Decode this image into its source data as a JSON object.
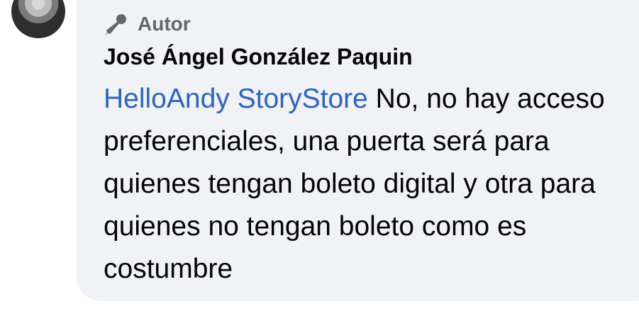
{
  "comment": {
    "badge_label": "Autor",
    "author_name": "José Ángel González Paquin",
    "mention": "HelloAndy StoryStore",
    "text": " No, no hay acceso preferenciales, una puerta será para quienes tengan boleto digital y otra para quienes no tengan boleto como es costumbre",
    "badge_icon": "microphone-icon",
    "colors": {
      "bubble_background": "#f0f2f5",
      "mention_link": "#2d64bc",
      "secondary_text": "#65676b",
      "primary_text": "#050505"
    }
  }
}
